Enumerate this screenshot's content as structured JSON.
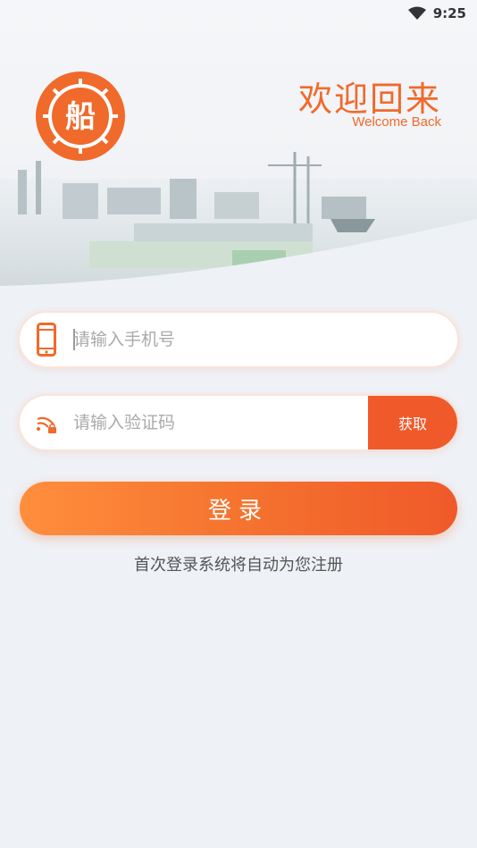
{
  "status_bar": {
    "time": "9:25",
    "wifi": "wifi-icon"
  },
  "header": {
    "logo_char": "船",
    "title": "欢迎回来",
    "subtitle": "Welcome Back"
  },
  "form": {
    "phone": {
      "placeholder": "请输入手机号",
      "value": "",
      "icon": "phone-icon"
    },
    "code": {
      "placeholder": "请输入验证码",
      "value": "",
      "icon": "signal-lock-icon",
      "get_code_label": "获取"
    },
    "login_label": "登录",
    "hint": "首次登录系统将自动为您注册"
  },
  "colors": {
    "accent": "#f06a2b",
    "accent_dark": "#f0592a",
    "accent_light": "#ff8e3d",
    "background": "#eef1f6"
  }
}
